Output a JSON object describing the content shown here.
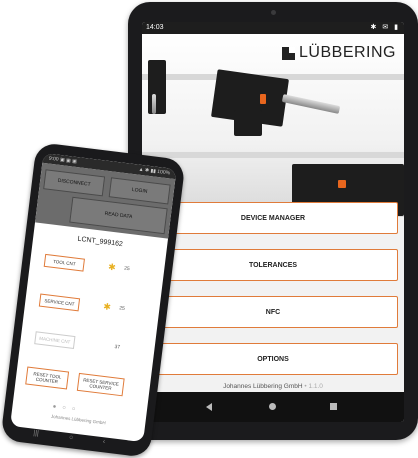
{
  "tablet": {
    "status_time": "14:03",
    "status_icons": "✱ ✉ ▮",
    "brand": "LÜBBERING",
    "menu": [
      {
        "label": "DEVICE MANAGER"
      },
      {
        "label": "TOLERANCES"
      },
      {
        "label": "NFC"
      },
      {
        "label": "OPTIONS"
      }
    ],
    "footer_company": "Johannes Lübbering GmbH",
    "footer_version": " • 1.1.0"
  },
  "phone": {
    "status_left": "9:00 ▣ ▣ ▣",
    "status_right": "▲ ✱ ▮▮ 100%",
    "disconnect": "DISCONNECT",
    "login": "LOGIN",
    "read_data": "READ DATA",
    "serial": "LCNT_999162",
    "tool_cnt": "TOOL CNT",
    "service_cnt": "SERVICE CNT",
    "machine_cnt": "MACHINE CNT",
    "tool_val": "25",
    "service_val": "25",
    "machine_val": "37",
    "reset_tool": "RESET TOOL COUNTER",
    "reset_service": "RESET SERVICE COUNTER",
    "footer": "Johannes Lübbering GmbH"
  },
  "colors": {
    "accent": "#e07b3a",
    "dark": "#1b1b1d",
    "gear": "#e8b021"
  }
}
